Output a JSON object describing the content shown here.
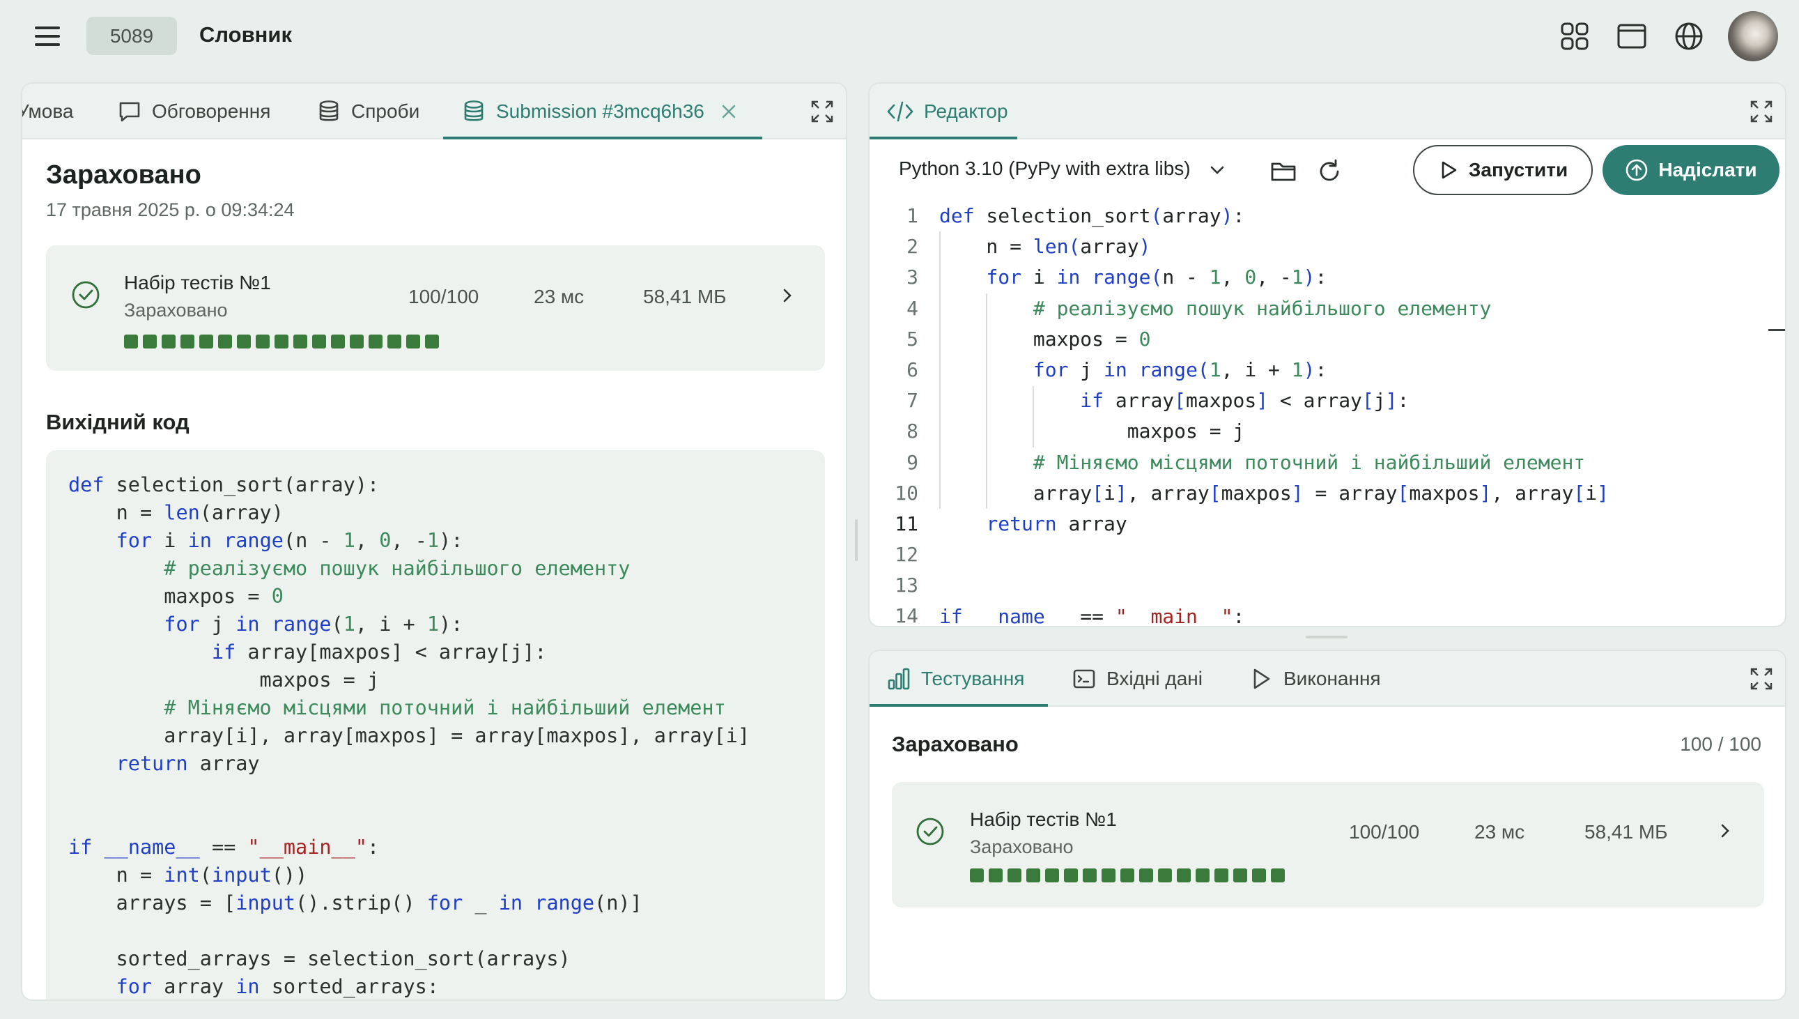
{
  "header": {
    "problem_id": "5089",
    "title": "Словник"
  },
  "left_tabs": [
    {
      "label": "Умова"
    },
    {
      "label": "Обговорення"
    },
    {
      "label": "Спроби"
    },
    {
      "label": "Submission #3mcq6h36",
      "active": true
    }
  ],
  "submission": {
    "status": "Зараховано",
    "date": "17 травня 2025 р. о 09:34:24",
    "test_set": {
      "name": "Набір тестів №1",
      "status": "Зараховано",
      "score": "100/100",
      "time": "23 мс",
      "memory": "58,41 МБ",
      "passed_tests": 17
    },
    "source_title": "Вихідний код"
  },
  "editor": {
    "tab_label": "Редактор",
    "language": "Python 3.10 (PyPy with extra libs)",
    "run_label": "Запустити",
    "submit_label": "Надіслати",
    "line_numbers": [
      "1",
      "2",
      "3",
      "4",
      "5",
      "6",
      "7",
      "8",
      "9",
      "10",
      "11",
      "12",
      "13",
      "14"
    ],
    "current_line": 11
  },
  "test_panel": {
    "tabs": [
      {
        "label": "Тестування",
        "active": true
      },
      {
        "label": "Вхідні дані"
      },
      {
        "label": "Виконання"
      }
    ],
    "status": "Зараховано",
    "score": "100 / 100",
    "test_set": {
      "name": "Набір тестів №1",
      "status": "Зараховано",
      "score": "100/100",
      "time": "23 мс",
      "memory": "58,41 МБ",
      "passed_tests": 17
    }
  },
  "colors": {
    "accent": "#2e7d72",
    "success_square": "#3a7a3b",
    "background": "#e9efec"
  }
}
